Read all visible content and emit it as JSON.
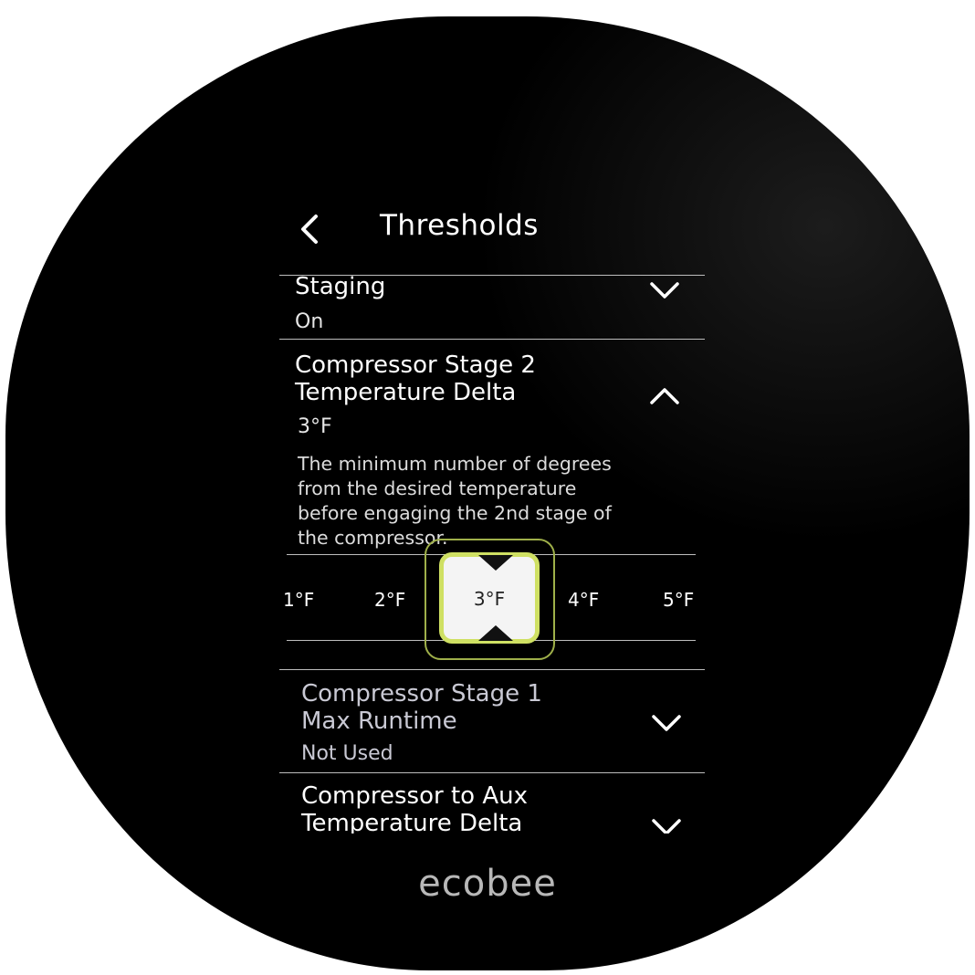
{
  "header": {
    "title": "Thresholds"
  },
  "settings": [
    {
      "title_line1": "Staging",
      "value": "On",
      "chevron": "chevron-down"
    },
    {
      "title_line1": "Compressor Stage 2",
      "title_line2": "Temperature Delta",
      "value": "3°F",
      "chevron": "chevron-up",
      "description_lines": [
        "The minimum number of degrees",
        "from the desired temperature",
        "before engaging the 2nd stage of",
        "the compressor."
      ]
    },
    {
      "title_line1": "Compressor Stage 1",
      "title_line2": "Max Runtime",
      "value": "Not Used",
      "chevron": "chevron-down"
    },
    {
      "title_line1": "Compressor to Aux",
      "title_line2": "Temperature Delta",
      "chevron": "chevron-down"
    }
  ],
  "picker": {
    "options": [
      "1°F",
      "2°F",
      "3°F",
      "4°F",
      "5°F"
    ],
    "selected": "3°F",
    "accent_color": "#cfe063"
  },
  "brand": "ecobee"
}
